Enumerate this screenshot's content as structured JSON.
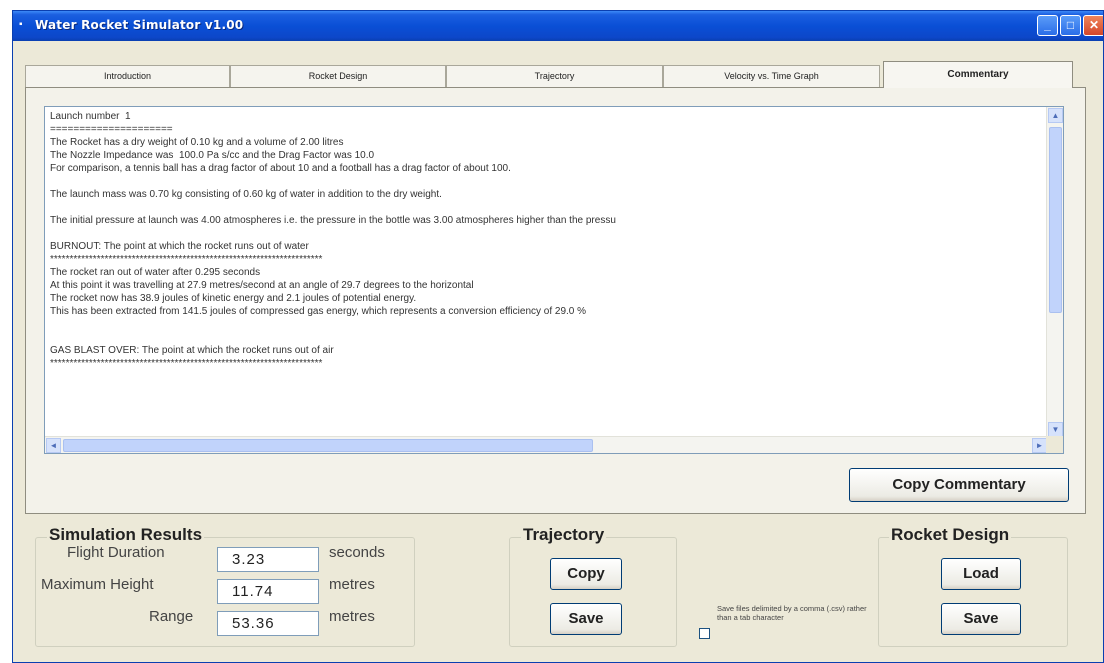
{
  "window": {
    "title": "Water Rocket Simulator v1.00",
    "minimize_glyph": "_",
    "maximize_glyph": "□",
    "close_glyph": "✕"
  },
  "tabs": [
    {
      "label": "Introduction",
      "active": false
    },
    {
      "label": "Rocket Design",
      "active": false
    },
    {
      "label": "Trajectory",
      "active": false
    },
    {
      "label": "Velocity vs. Time Graph",
      "active": false
    },
    {
      "label": "Commentary",
      "active": true
    }
  ],
  "commentary": {
    "lines": [
      "Launch number  1",
      "=====================",
      "The Rocket has a dry weight of 0.10 kg and a volume of 2.00 litres",
      "The Nozzle Impedance was  100.0 Pa s/cc and the Drag Factor was 10.0",
      "For comparison, a tennis ball has a drag factor of about 10 and a football has a drag factor of about 100.",
      "",
      "The launch mass was 0.70 kg consisting of 0.60 kg of water in addition to the dry weight.",
      "",
      "The initial pressure at launch was 4.00 atmospheres i.e. the pressure in the bottle was 3.00 atmospheres higher than the pressu",
      "",
      "BURNOUT: The point at which the rocket runs out of water",
      "**********************************************************************",
      "The rocket ran out of water after 0.295 seconds",
      "At this point it was travelling at 27.9 metres/second at an angle of 29.7 degrees to the horizontal",
      "The rocket now has 38.9 joules of kinetic energy and 2.1 joules of potential energy.",
      "This has been extracted from 141.5 joules of compressed gas energy, which represents a conversion efficiency of 29.0 %",
      "",
      "",
      "GAS BLAST OVER: The point at which the rocket runs out of air",
      "**********************************************************************"
    ],
    "copy_button": "Copy Commentary"
  },
  "simulation_results": {
    "title": "Simulation Results",
    "flight_duration": {
      "label": "Flight Duration",
      "value": "3.23",
      "unit": "seconds"
    },
    "maximum_height": {
      "label": "Maximum Height",
      "value": "11.74",
      "unit": "metres"
    },
    "range": {
      "label": "Range",
      "value": "53.36",
      "unit": "metres"
    }
  },
  "trajectory": {
    "title": "Trajectory",
    "copy_button": "Copy",
    "save_button": "Save"
  },
  "save_option": {
    "label": "Save files delimited by a comma (.csv) rather than a tab character",
    "checked": false
  },
  "rocket_design": {
    "title": "Rocket Design",
    "load_button": "Load",
    "save_button": "Save"
  },
  "scroll": {
    "up": "▲",
    "down": "▼",
    "left": "◄",
    "right": "►"
  }
}
